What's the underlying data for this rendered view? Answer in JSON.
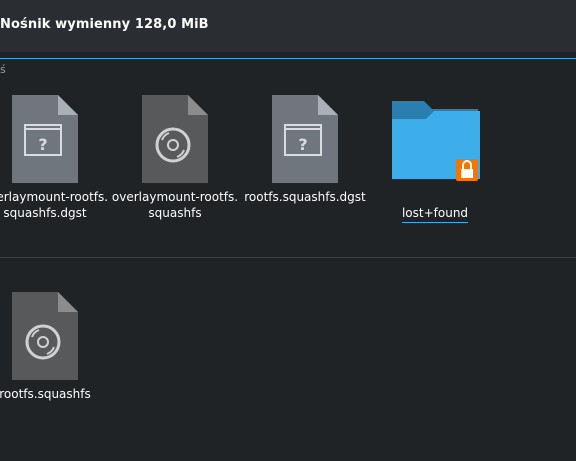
{
  "window": {
    "title": "Nośnik wymienny 128,0 MiB"
  },
  "section": {
    "label": "ś"
  },
  "files": [
    {
      "name": "overlaymount-rootfs.\nsquashfs.dgst",
      "icon": "unknown-file-icon"
    },
    {
      "name": "overlaymount-rootfs.\nsquashfs",
      "icon": "disk-image-icon"
    },
    {
      "name": "rootfs.squashfs.dgst",
      "icon": "unknown-file-icon"
    },
    {
      "name": "lost+found",
      "icon": "locked-folder-icon"
    },
    {
      "name": "rootfs.squashfs",
      "icon": "disk-image-icon"
    }
  ],
  "colors": {
    "accent": "#3daee9",
    "background": "#202326",
    "folder": "#3daee9",
    "lock_badge": "#f67400"
  }
}
